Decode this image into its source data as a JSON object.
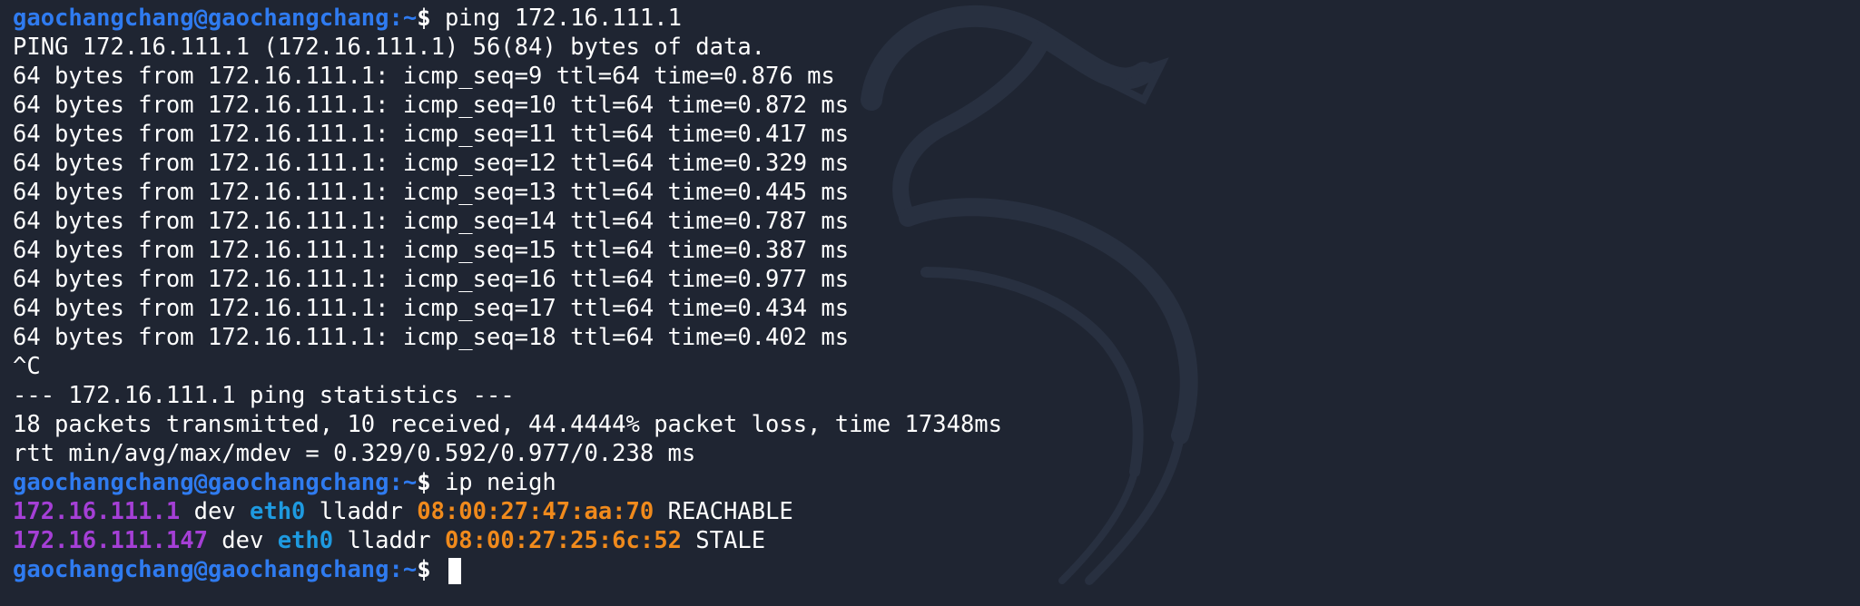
{
  "prompt": {
    "user_host": "gaochangchang@gaochangchang",
    "separator": ":",
    "path": "~",
    "dollar": "$ "
  },
  "commands": {
    "ping": "ping 172.16.111.1",
    "ip_neigh": "ip neigh"
  },
  "ping_output": {
    "header": "PING 172.16.111.1 (172.16.111.1) 56(84) bytes of data.",
    "replies": [
      "64 bytes from 172.16.111.1: icmp_seq=9 ttl=64 time=0.876 ms",
      "64 bytes from 172.16.111.1: icmp_seq=10 ttl=64 time=0.872 ms",
      "64 bytes from 172.16.111.1: icmp_seq=11 ttl=64 time=0.417 ms",
      "64 bytes from 172.16.111.1: icmp_seq=12 ttl=64 time=0.329 ms",
      "64 bytes from 172.16.111.1: icmp_seq=13 ttl=64 time=0.445 ms",
      "64 bytes from 172.16.111.1: icmp_seq=14 ttl=64 time=0.787 ms",
      "64 bytes from 172.16.111.1: icmp_seq=15 ttl=64 time=0.387 ms",
      "64 bytes from 172.16.111.1: icmp_seq=16 ttl=64 time=0.977 ms",
      "64 bytes from 172.16.111.1: icmp_seq=17 ttl=64 time=0.434 ms",
      "64 bytes from 172.16.111.1: icmp_seq=18 ttl=64 time=0.402 ms"
    ],
    "interrupt": "^C",
    "stats_header": "--- 172.16.111.1 ping statistics ---",
    "stats_summary": "18 packets transmitted, 10 received, 44.4444% packet loss, time 17348ms",
    "rtt": "rtt min/avg/max/mdev = 0.329/0.592/0.977/0.238 ms"
  },
  "neighbors": [
    {
      "ip": "172.16.111.1",
      "dev_label": " dev ",
      "dev": "eth0",
      "lladdr_label": " lladdr ",
      "mac": "08:00:27:47:aa:70",
      "state": " REACHABLE"
    },
    {
      "ip": "172.16.111.147",
      "dev_label": " dev ",
      "dev": "eth0",
      "lladdr_label": " lladdr ",
      "mac": "08:00:27:25:6c:52",
      "state": " STALE"
    }
  ],
  "icons": {
    "watermark": "kali-dragon-icon",
    "cursor": "block-cursor"
  },
  "colors": {
    "background": "#1f2532",
    "prompt": "#2f7bf0",
    "ip": "#a53fd6",
    "device": "#1e9ae0",
    "mac": "#f08a1c",
    "text": "#ffffff"
  }
}
